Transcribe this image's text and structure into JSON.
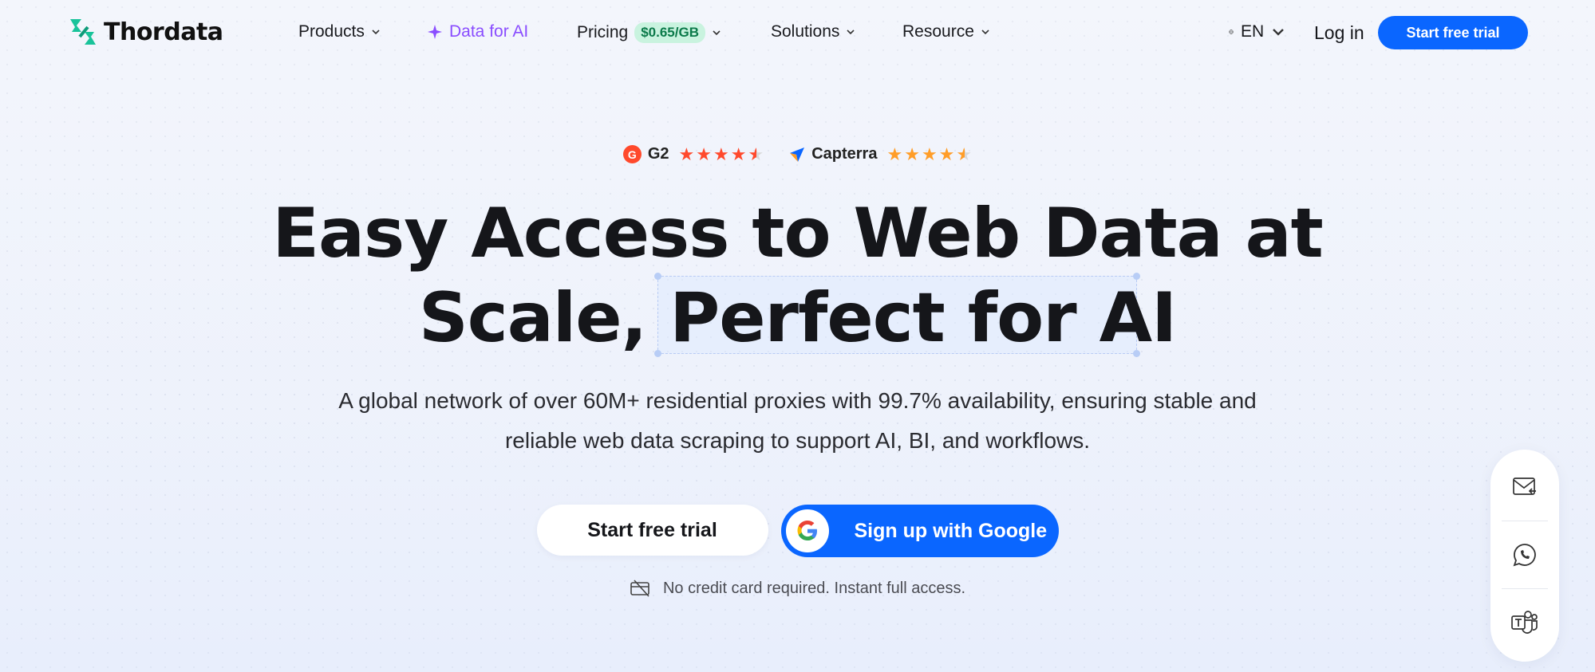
{
  "brand": {
    "name": "Thordata"
  },
  "nav": {
    "products": "Products",
    "data_for_ai": "Data for AI",
    "pricing": "Pricing",
    "pricing_badge": "$0.65/GB",
    "solutions": "Solutions",
    "resource": "Resource",
    "language": "EN",
    "login": "Log in",
    "cta": "Start free trial"
  },
  "ratings": [
    {
      "name": "G2",
      "stars": 4.5,
      "color": "#ff492c"
    },
    {
      "name": "Capterra",
      "stars": 4.5,
      "color": "#ff9d28"
    }
  ],
  "hero": {
    "title_line1": "Easy Access to Web Data at",
    "title_line2": "Scale, Perfect for AI",
    "subtitle_line1": "A global network of over 60M+ residential proxies with 99.7% availability, ensuring stable and",
    "subtitle_line2": "reliable web data scraping to support AI, BI, and workflows.",
    "primary_button": "Start free trial",
    "google_button": "Sign up with Google",
    "note": "No credit card required. Instant full access."
  },
  "side_contacts": [
    "mail-icon",
    "whatsapp-icon",
    "teams-icon"
  ],
  "colors": {
    "accent": "#0a66ff",
    "ai_purple": "#8a4dff",
    "badge_green": "#c9f3df"
  }
}
